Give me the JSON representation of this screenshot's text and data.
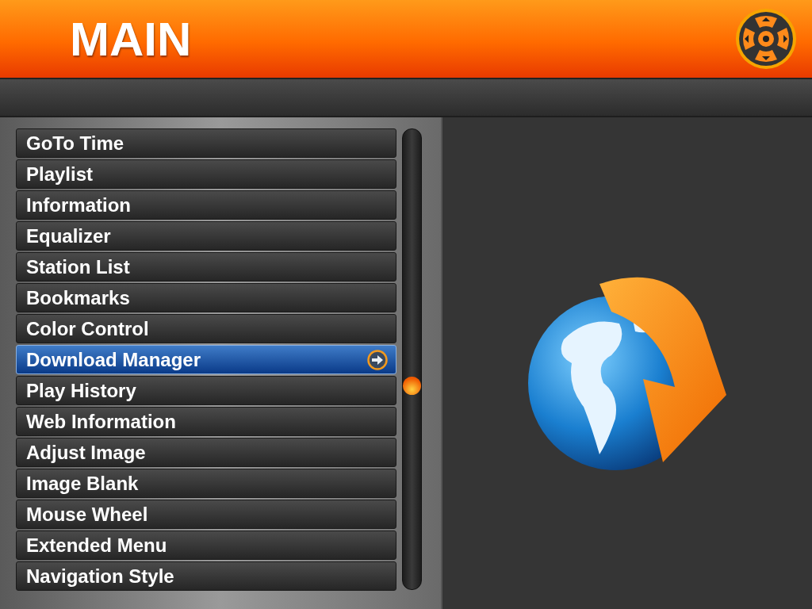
{
  "header": {
    "title": "MAIN"
  },
  "menu": {
    "items": [
      {
        "label": "GoTo Time",
        "selected": false
      },
      {
        "label": "Playlist",
        "selected": false
      },
      {
        "label": "Information",
        "selected": false
      },
      {
        "label": "Equalizer",
        "selected": false
      },
      {
        "label": "Station List",
        "selected": false
      },
      {
        "label": "Bookmarks",
        "selected": false
      },
      {
        "label": "Color Control",
        "selected": false
      },
      {
        "label": "Download Manager",
        "selected": true
      },
      {
        "label": "Play History",
        "selected": false
      },
      {
        "label": "Web Information",
        "selected": false
      },
      {
        "label": "Adjust Image",
        "selected": false
      },
      {
        "label": "Image Blank",
        "selected": false
      },
      {
        "label": "Mouse Wheel",
        "selected": false
      },
      {
        "label": "Extended Menu",
        "selected": false
      },
      {
        "label": "Navigation Style",
        "selected": false
      }
    ]
  }
}
